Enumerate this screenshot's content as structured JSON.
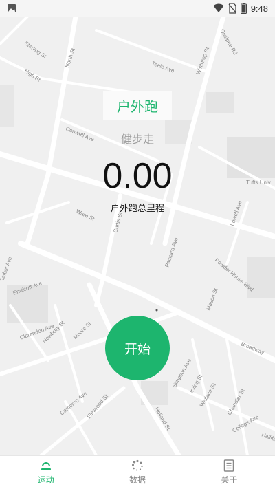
{
  "status_bar": {
    "time": "9:48",
    "icons": [
      "image-icon",
      "wifi-icon",
      "no-sim-icon",
      "battery-icon"
    ]
  },
  "map": {
    "street_labels": [
      "Sterling St",
      "North St",
      "High St",
      "Teele Ave",
      "Winthrop St",
      "Ossipee Rd",
      "Conwell Ave",
      "Tufts Univ",
      "Ware St",
      "Curtis St",
      "Packard Ave",
      "Powder House Blvd",
      "Lowell Ave",
      "Endicott Ave",
      "Talbot Ave",
      "Clarendon Ave",
      "Newbury St",
      "Moore St",
      "Mason St",
      "Broadway",
      "Cameron Ave",
      "Elmwood St",
      "Holland St",
      "Simpson Ave",
      "Irving St",
      "Wallace St",
      "Chandler St",
      "College Ave",
      "Halliburton Ave"
    ]
  },
  "run": {
    "mode_outdoor": "户外跑",
    "mode_walk": "健步走",
    "distance_value": "0.00",
    "distance_label": "户外跑总里程",
    "start_label": "开始"
  },
  "nav": {
    "items": [
      {
        "label": "运动",
        "icon": "sport-icon",
        "active": true
      },
      {
        "label": "数据",
        "icon": "data-icon",
        "active": false
      },
      {
        "label": "关于",
        "icon": "about-icon",
        "active": false
      }
    ]
  },
  "colors": {
    "accent": "#1db56e",
    "inactive": "#888888",
    "map_bg": "#f0f0f0",
    "road": "#ffffff"
  }
}
